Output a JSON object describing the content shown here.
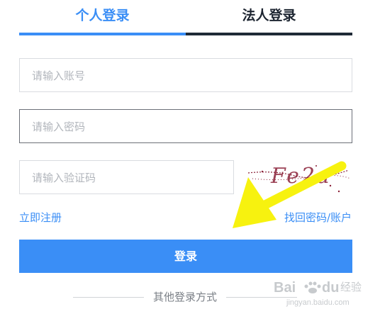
{
  "tabs": [
    {
      "label": "个人登录",
      "active": true
    },
    {
      "label": "法人登录",
      "active": false
    }
  ],
  "form": {
    "account_placeholder": "请输入账号",
    "password_placeholder": "请输入密码",
    "captcha_placeholder": "请输入验证码",
    "captcha_image_text": "Fe2a"
  },
  "links": {
    "register": "立即注册",
    "recover": "找回密码/账户"
  },
  "login_button": "登录",
  "other_login": "其他登录方式",
  "watermark": {
    "brand": "Bai",
    "brand_suffix": "du",
    "cn": "经验",
    "url": "jingyan.baidu.com"
  },
  "colors": {
    "accent": "#3a8ef6",
    "annotation_arrow": "#f7f20f",
    "captcha_ink": "#8a2138"
  },
  "icons": {
    "annotation": "arrow-icon",
    "watermark": "paw-icon"
  }
}
